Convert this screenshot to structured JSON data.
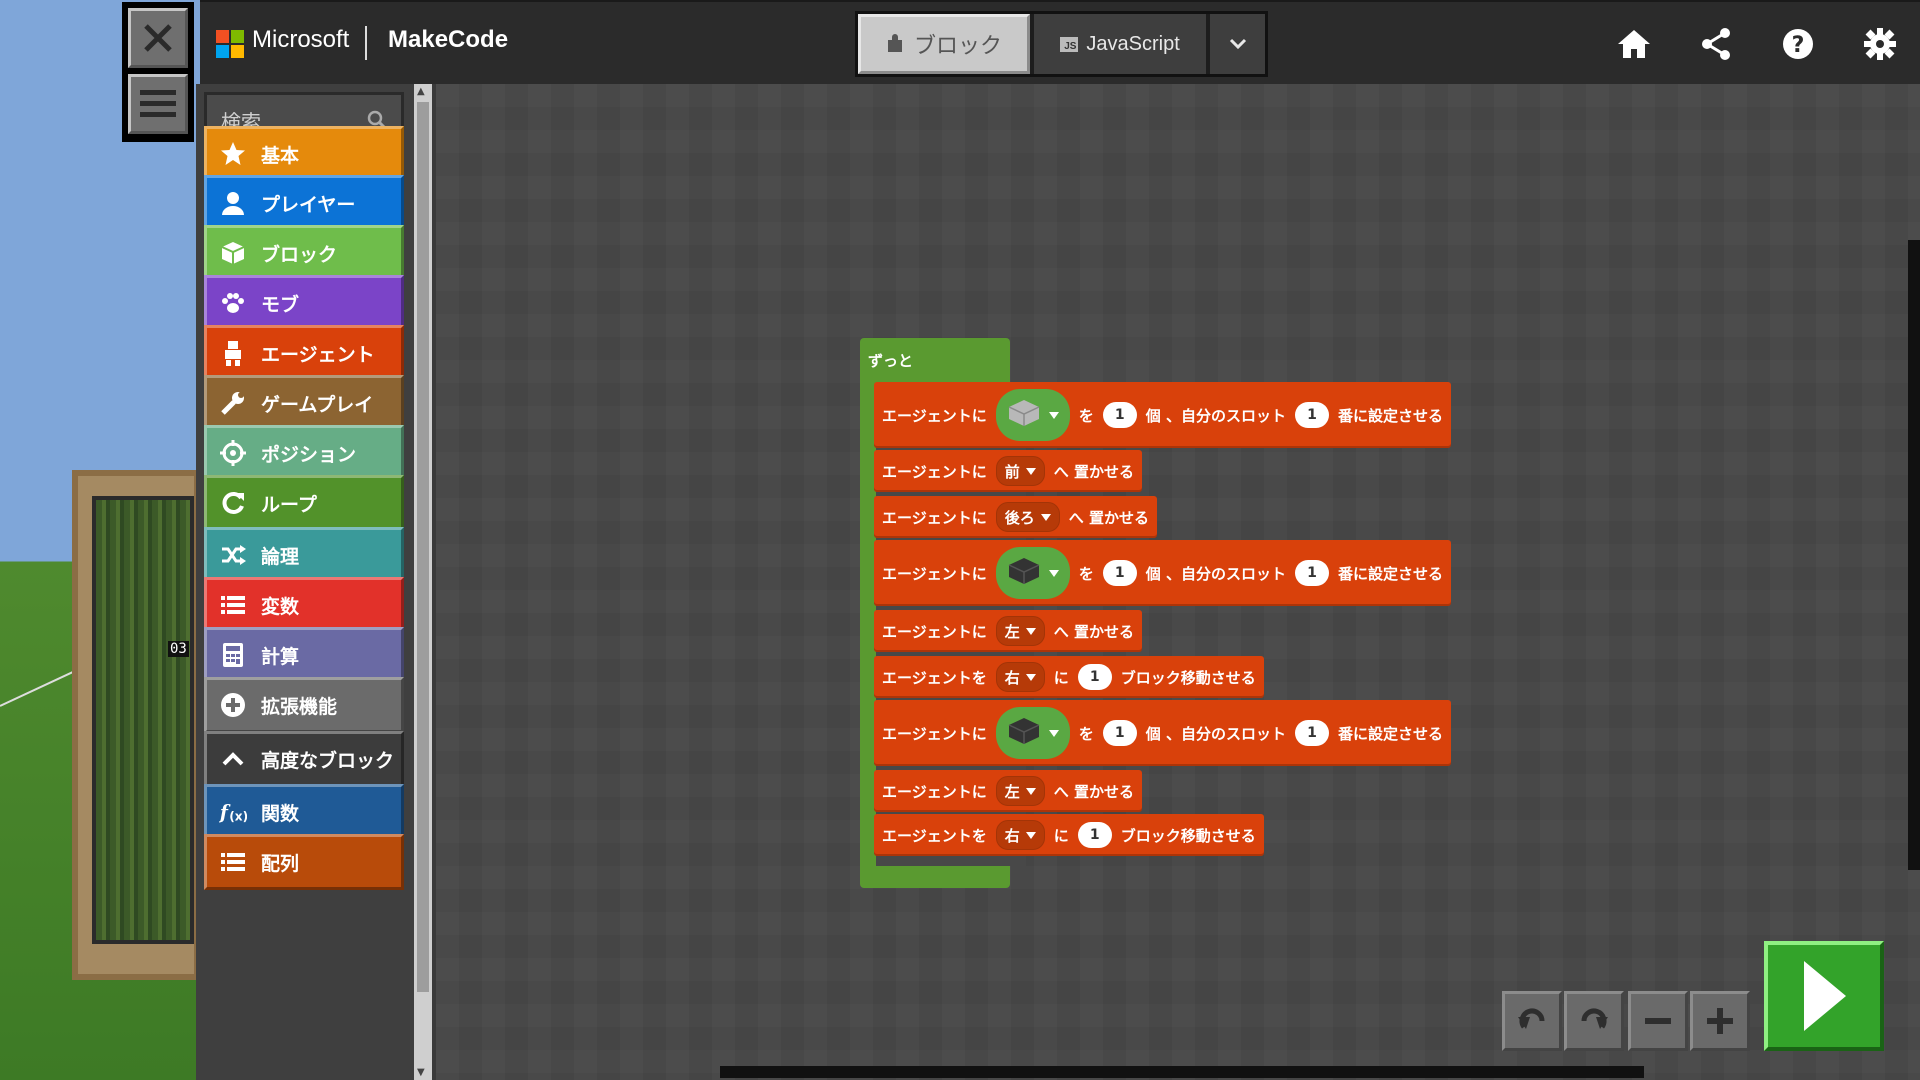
{
  "header": {
    "brand_ms": "Microsoft",
    "brand_mc": "MakeCode",
    "tabs": {
      "blocks": "ブロック",
      "javascript": "JavaScript"
    }
  },
  "toolbox": {
    "search_placeholder": "検索...",
    "categories": [
      {
        "label": "基本",
        "color": "#e58a0c",
        "icon": "star-icon"
      },
      {
        "label": "プレイヤー",
        "color": "#0c73d6",
        "icon": "person-icon"
      },
      {
        "label": "ブロック",
        "color": "#6fbd4b",
        "icon": "cube-icon"
      },
      {
        "label": "モブ",
        "color": "#7b44c8",
        "icon": "paw-icon"
      },
      {
        "label": "エージェント",
        "color": "#d9410b",
        "icon": "agent-icon"
      },
      {
        "label": "ゲームプレイ",
        "color": "#8c6432",
        "icon": "wrench-icon"
      },
      {
        "label": "ポジション",
        "color": "#66ad86",
        "icon": "crosshair-icon"
      },
      {
        "label": "ループ",
        "color": "#52922a",
        "icon": "loop-icon"
      },
      {
        "label": "論理",
        "color": "#3a9a9a",
        "icon": "shuffle-icon"
      },
      {
        "label": "変数",
        "color": "#e2312a",
        "icon": "list-icon"
      },
      {
        "label": "計算",
        "color": "#6a6aa4",
        "icon": "calculator-icon"
      },
      {
        "label": "拡張機能",
        "color": "#6b6b6b",
        "icon": "plus-circle-icon"
      },
      {
        "label": "高度なブロック",
        "color": "#3c3c3c",
        "icon": "chevron-up-icon"
      },
      {
        "label": "関数",
        "color": "#1f5a96",
        "icon": "function-icon"
      },
      {
        "label": "配列",
        "color": "#b84b0a",
        "icon": "list-icon"
      }
    ]
  },
  "program": {
    "forever_label": "ずっと",
    "blocks": [
      {
        "type": "set_item",
        "t1": "エージェントに",
        "t2": "を",
        "count": "1",
        "t3": "個 、自分のスロット",
        "slot": "1",
        "t4": "番に設定させる",
        "item": "stone"
      },
      {
        "type": "place",
        "t1": "エージェントに",
        "dir": "前",
        "t2": "へ 置かせる"
      },
      {
        "type": "place",
        "t1": "エージェントに",
        "dir": "後ろ",
        "t2": "へ 置かせる"
      },
      {
        "type": "set_item",
        "t1": "エージェントに",
        "t2": "を",
        "count": "1",
        "t3": "個 、自分のスロット",
        "slot": "1",
        "t4": "番に設定させる",
        "item": "coal"
      },
      {
        "type": "place",
        "t1": "エージェントに",
        "dir": "左",
        "t2": "へ 置かせる"
      },
      {
        "type": "move",
        "t1": "エージェントを",
        "dir": "右",
        "t2": "に",
        "count": "1",
        "t3": "ブロック移動させる"
      },
      {
        "type": "set_item",
        "t1": "エージェントに",
        "t2": "を",
        "count": "1",
        "t3": "個 、自分のスロット",
        "slot": "1",
        "t4": "番に設定させる",
        "item": "coal"
      },
      {
        "type": "place",
        "t1": "エージェントに",
        "dir": "左",
        "t2": "へ 置かせる"
      },
      {
        "type": "move",
        "t1": "エージェントを",
        "dir": "右",
        "t2": "に",
        "count": "1",
        "t3": "ブロック移動させる"
      }
    ]
  },
  "world": {
    "map_tag": "03"
  }
}
